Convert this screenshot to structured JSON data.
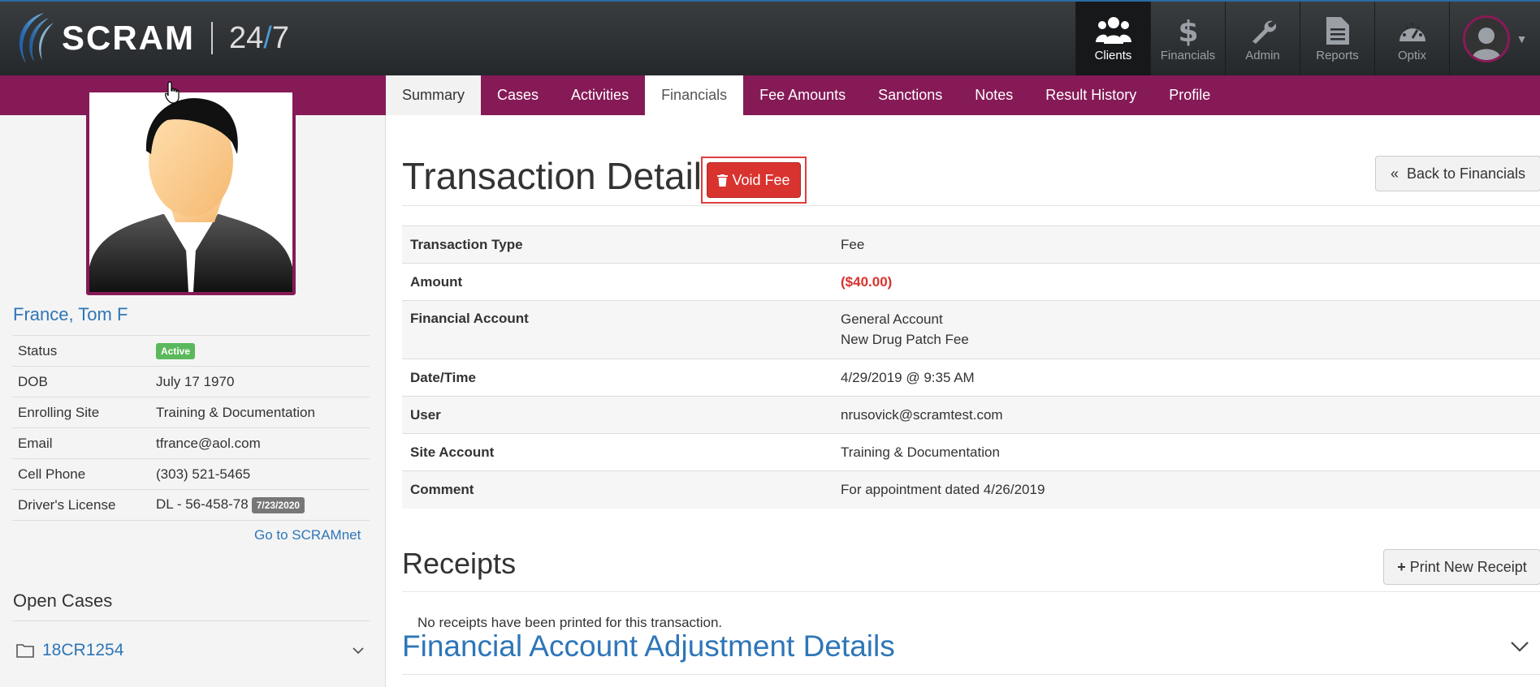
{
  "brand": {
    "name": "SCRAM",
    "product_prefix": "24",
    "product_slash": "/",
    "product_suffix": "7"
  },
  "nav": {
    "items": [
      {
        "label": "Clients",
        "icon": "clients-icon",
        "active": true
      },
      {
        "label": "Financials",
        "icon": "dollar-icon"
      },
      {
        "label": "Admin",
        "icon": "wrench-icon"
      },
      {
        "label": "Reports",
        "icon": "document-icon"
      },
      {
        "label": "Optix",
        "icon": "dashboard-gauge-icon"
      }
    ]
  },
  "tabs": [
    "Summary",
    "Cases",
    "Activities",
    "Financials",
    "Fee Amounts",
    "Sanctions",
    "Notes",
    "Result History",
    "Profile"
  ],
  "active_tab": "Financials",
  "client": {
    "name": "France, Tom F",
    "fields": [
      {
        "label": "Status",
        "value": "Active",
        "badge": "Active"
      },
      {
        "label": "DOB",
        "value": "July 17 1970"
      },
      {
        "label": "Enrolling Site",
        "value": "Training & Documentation"
      },
      {
        "label": "Email",
        "value": "tfrance@aol.com"
      },
      {
        "label": "Cell Phone",
        "value": "(303) 521-5465"
      },
      {
        "label": "Driver's License",
        "value": "DL - 56-458-78",
        "badge": "7/23/2020"
      }
    ],
    "scramnet_link": "Go to SCRAMnet"
  },
  "open_cases": {
    "heading": "Open Cases",
    "cases": [
      "18CR1254"
    ]
  },
  "transaction": {
    "title": "Transaction Detail",
    "void_label": "Void Fee",
    "back_label": "Back to Financials",
    "rows": [
      {
        "label": "Transaction Type",
        "value": "Fee"
      },
      {
        "label": "Amount",
        "value": "($40.00)"
      },
      {
        "label": "Financial Account",
        "value": "General Account",
        "value2": "New Drug Patch Fee"
      },
      {
        "label": "Date/Time",
        "value": "4/29/2019 @ 9:35 AM"
      },
      {
        "label": "User",
        "value": "nrusovick@scramtest.com"
      },
      {
        "label": "Site Account",
        "value": "Training & Documentation"
      },
      {
        "label": "Comment",
        "value": "For appointment dated 4/26/2019"
      }
    ]
  },
  "receipts": {
    "title": "Receipts",
    "print_label": "Print New Receipt",
    "empty_text": "No receipts have been printed for this transaction."
  },
  "adjustments": {
    "title": "Financial Account Adjustment Details"
  },
  "colors": {
    "brand_magenta": "#861a57",
    "link_blue": "#2e76b8",
    "danger_red": "#d9332f",
    "success_green": "#5cb85c"
  }
}
